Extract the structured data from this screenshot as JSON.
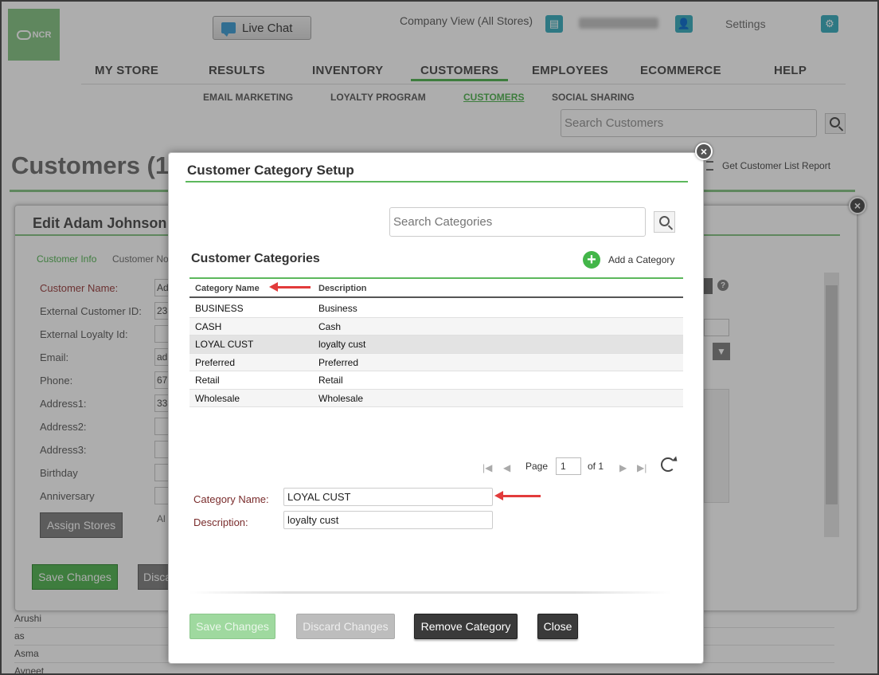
{
  "header": {
    "logo_text": "NCR",
    "live_chat_label": "Live Chat",
    "company_view": "Company View (All Stores)",
    "settings_label": "Settings"
  },
  "main_nav": [
    {
      "label": "MY STORE",
      "active": false
    },
    {
      "label": "RESULTS",
      "active": false
    },
    {
      "label": "INVENTORY",
      "active": false
    },
    {
      "label": "CUSTOMERS",
      "active": true
    },
    {
      "label": "EMPLOYEES",
      "active": false
    },
    {
      "label": "ECOMMERCE",
      "active": false
    },
    {
      "label": "HELP",
      "active": false
    }
  ],
  "sub_nav": [
    {
      "label": "EMAIL MARKETING",
      "active": false
    },
    {
      "label": "LOYALTY PROGRAM",
      "active": false
    },
    {
      "label": "CUSTOMERS",
      "active": true
    },
    {
      "label": "SOCIAL SHARING",
      "active": false
    }
  ],
  "customer_search": {
    "placeholder": "Search Customers"
  },
  "page": {
    "title": "Customers (1",
    "report_link": "Get Customer List Report"
  },
  "edit_panel": {
    "title": "Edit Adam Johnson",
    "tabs": [
      "Customer Info",
      "Customer No"
    ],
    "fields": [
      {
        "label": "Customer Name:",
        "value": "Ad",
        "required": true
      },
      {
        "label": "External Customer ID:",
        "value": "23",
        "required": false
      },
      {
        "label": "External Loyalty Id:",
        "value": "",
        "required": false
      },
      {
        "label": "Email:",
        "value": "ad",
        "required": false
      },
      {
        "label": "Phone:",
        "value": "67",
        "required": false
      },
      {
        "label": "Address1:",
        "value": "33",
        "required": false
      },
      {
        "label": "Address2:",
        "value": "",
        "required": false
      },
      {
        "label": "Address3:",
        "value": "",
        "required": false
      },
      {
        "label": "Birthday",
        "value": "",
        "required": false
      },
      {
        "label": "Anniversary",
        "value": "",
        "required": false
      }
    ],
    "assign_stores": "Assign Stores",
    "all_text": "Al",
    "save_changes": "Save Changes",
    "discard_partial": "Discar"
  },
  "bg_list": [
    "Arushi",
    "as",
    "Asma",
    "Avneet"
  ],
  "modal": {
    "title": "Customer Category Setup",
    "search_placeholder": "Search Categories",
    "section_title": "Customer Categories",
    "add_label": "Add a Category",
    "columns": [
      "Category Name",
      "Description"
    ],
    "rows": [
      {
        "name": "BUSINESS",
        "description": "Business"
      },
      {
        "name": "CASH",
        "description": "Cash"
      },
      {
        "name": "LOYAL CUST",
        "description": "loyalty cust"
      },
      {
        "name": "Preferred",
        "description": "Preferred"
      },
      {
        "name": "Retail",
        "description": "Retail"
      },
      {
        "name": "Wholesale",
        "description": "Wholesale"
      }
    ],
    "selected_row": 2,
    "pager": {
      "page_label": "Page",
      "page_value": "1",
      "of_label": "of 1"
    },
    "form": {
      "category_name_label": "Category Name:",
      "category_name_value": "LOYAL CUST",
      "description_label": "Description:",
      "description_value": "loyalty cust"
    },
    "buttons": {
      "save": "Save Changes",
      "discard": "Discard Changes",
      "remove": "Remove Category",
      "close": "Close"
    }
  },
  "colors": {
    "accent_green": "#5cb85c",
    "teal_icon": "#44b2c2",
    "annotation_red": "#e23b3b"
  }
}
